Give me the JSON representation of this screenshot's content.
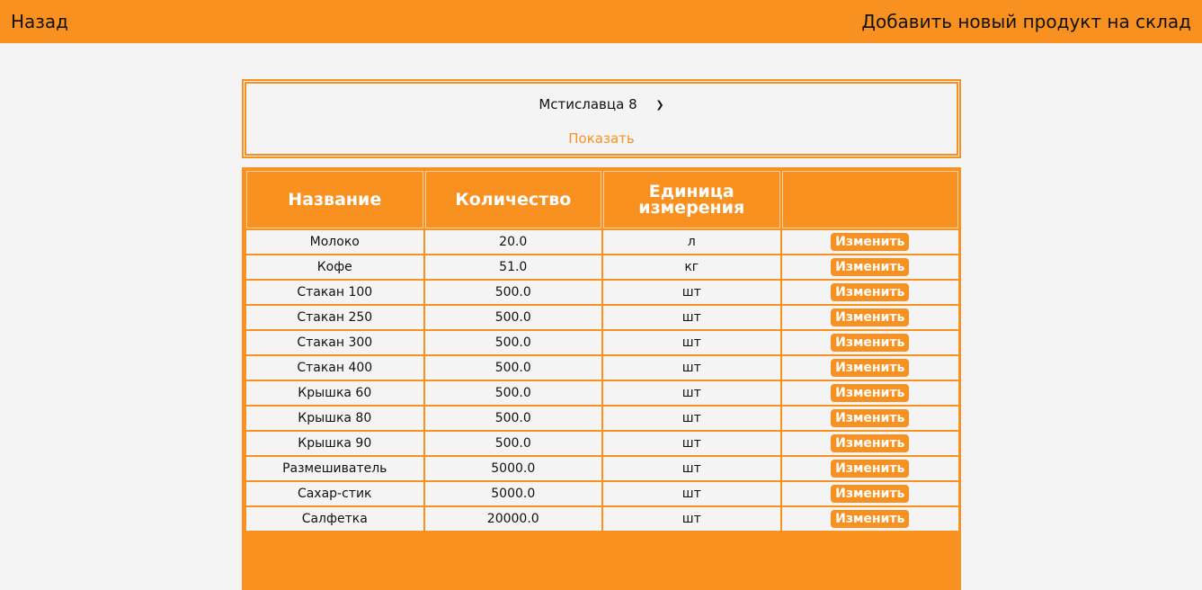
{
  "nav": {
    "back_label": "Назад",
    "add_label": "Добавить новый продукт на склад"
  },
  "filter": {
    "selected_location": "Мстиславца 8",
    "show_label": "Показать"
  },
  "table": {
    "headers": [
      "Название",
      "Количество",
      "Единица измерения",
      ""
    ],
    "edit_label": "Изменить",
    "rows": [
      {
        "name": "Молоко",
        "qty": "20.0",
        "unit": "л"
      },
      {
        "name": "Кофе",
        "qty": "51.0",
        "unit": "кг"
      },
      {
        "name": "Стакан 100",
        "qty": "500.0",
        "unit": "шт"
      },
      {
        "name": "Стакан 250",
        "qty": "500.0",
        "unit": "шт"
      },
      {
        "name": "Стакан 300",
        "qty": "500.0",
        "unit": "шт"
      },
      {
        "name": "Стакан 400",
        "qty": "500.0",
        "unit": "шт"
      },
      {
        "name": "Крышка 60",
        "qty": "500.0",
        "unit": "шт"
      },
      {
        "name": "Крышка 80",
        "qty": "500.0",
        "unit": "шт"
      },
      {
        "name": "Крышка 90",
        "qty": "500.0",
        "unit": "шт"
      },
      {
        "name": "Размешиватель",
        "qty": "5000.0",
        "unit": "шт"
      },
      {
        "name": "Сахар-стик",
        "qty": "5000.0",
        "unit": "шт"
      },
      {
        "name": "Салфетка",
        "qty": "20000.0",
        "unit": "шт"
      }
    ]
  },
  "colors": {
    "accent": "#f99120",
    "background": "#f4f4f4"
  }
}
